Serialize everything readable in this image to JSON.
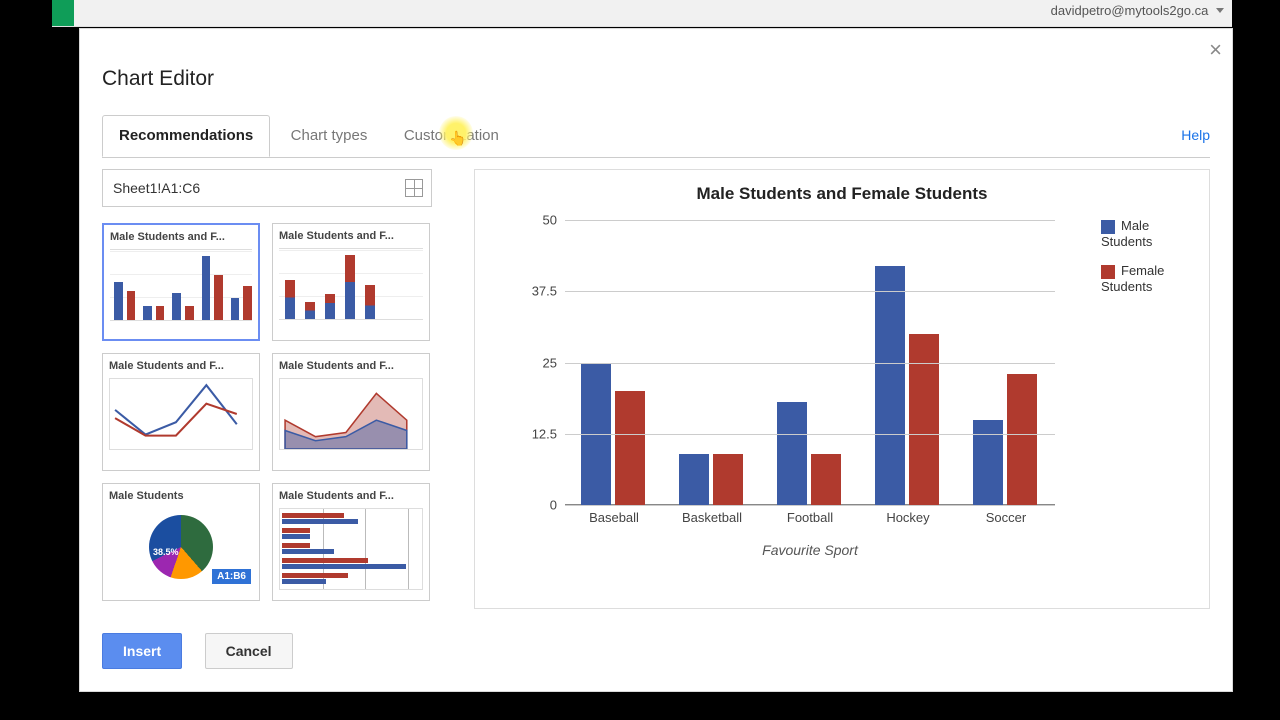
{
  "account_email": "davidpetro@mytools2go.ca",
  "dialog": {
    "title": "Chart Editor",
    "help": "Help",
    "tabs": {
      "recommendations": "Recommendations",
      "chart_types": "Chart types",
      "customization": "Customization"
    },
    "range_value": "Sheet1!A1:C6",
    "insert_label": "Insert",
    "cancel_label": "Cancel"
  },
  "thumbnails": [
    {
      "title": "Male Students and F..."
    },
    {
      "title": "Male Students and F..."
    },
    {
      "title": "Male Students and F..."
    },
    {
      "title": "Male Students and F..."
    },
    {
      "title": "Male Students",
      "pie_pct": "38.5%",
      "range": "A1:B6"
    },
    {
      "title": "Male Students and F..."
    }
  ],
  "chart_data": {
    "type": "bar",
    "title": "Male Students and Female Students",
    "xlabel": "Favourite Sport",
    "ylabel": "",
    "ylim": [
      0,
      50
    ],
    "yticks": [
      0,
      12.5,
      25,
      37.5,
      50
    ],
    "categories": [
      "Baseball",
      "Basketball",
      "Football",
      "Hockey",
      "Soccer"
    ],
    "series": [
      {
        "name": "Male Students",
        "color": "#3b5ba5",
        "values": [
          25,
          9,
          18,
          42,
          15
        ]
      },
      {
        "name": "Female Students",
        "color": "#b03a2e",
        "values": [
          20,
          9,
          9,
          30,
          23
        ]
      }
    ]
  }
}
